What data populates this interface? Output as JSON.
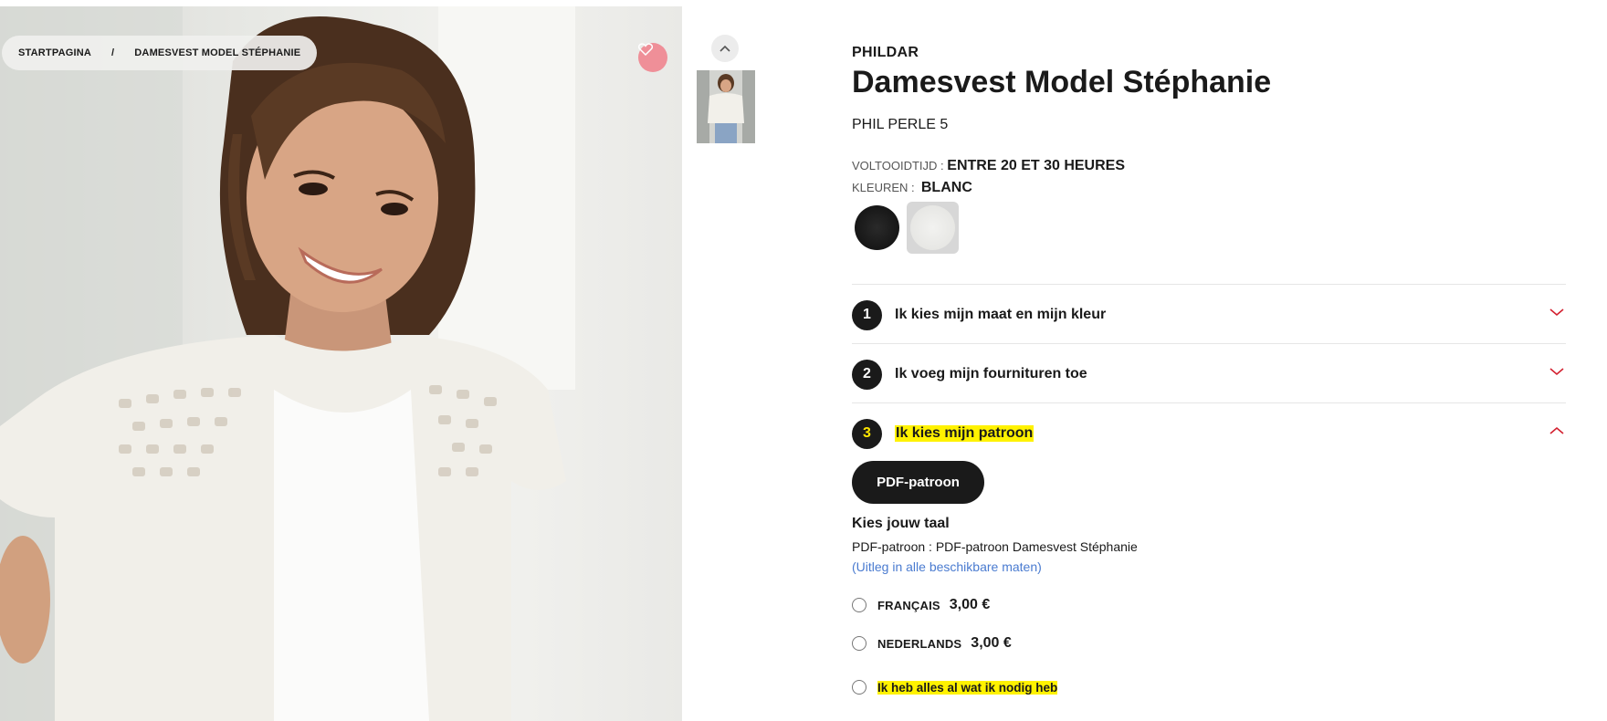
{
  "breadcrumb": {
    "home": "STARTPAGINA",
    "separator": "/",
    "current": "DAMESVEST MODEL STÉPHANIE"
  },
  "product": {
    "brand": "PHILDAR",
    "title": "Damesvest Model Stéphanie",
    "yarn": "PHIL PERLE 5",
    "completion_label": "VOLTOOIDTIJD :",
    "completion_value": "ENTRE 20 ET 30 HEURES",
    "colors_label": "KLEUREN :",
    "colors_value": "BLANC",
    "swatches": [
      {
        "name": "black",
        "color": "#151515",
        "selected": false
      },
      {
        "name": "white",
        "color": "#ececea",
        "selected": true
      }
    ]
  },
  "steps": [
    {
      "number": "1",
      "label": "Ik kies mijn maat en mijn kleur",
      "expanded": false
    },
    {
      "number": "2",
      "label": "Ik voeg mijn fournituren toe",
      "expanded": false
    },
    {
      "number": "3",
      "label": "Ik kies mijn patroon",
      "expanded": true
    }
  ],
  "pattern": {
    "button_label": "PDF-patroon",
    "language_heading": "Kies jouw taal",
    "description": "PDF-patroon : PDF-patroon Damesvest Stéphanie",
    "note": "(Uitleg in alle beschikbare maten)",
    "options": [
      {
        "label": "FRANÇAIS",
        "price": "3,00 €"
      },
      {
        "label": "NEDERLANDS",
        "price": "3,00 €"
      }
    ],
    "have_all_label": "Ik heb alles al wat ik nodig heb"
  },
  "colors": {
    "accent_red": "#d3202f",
    "highlight_yellow": "#fff200",
    "favorite_bg": "#ef8f98",
    "link_blue": "#4a7bd0"
  }
}
